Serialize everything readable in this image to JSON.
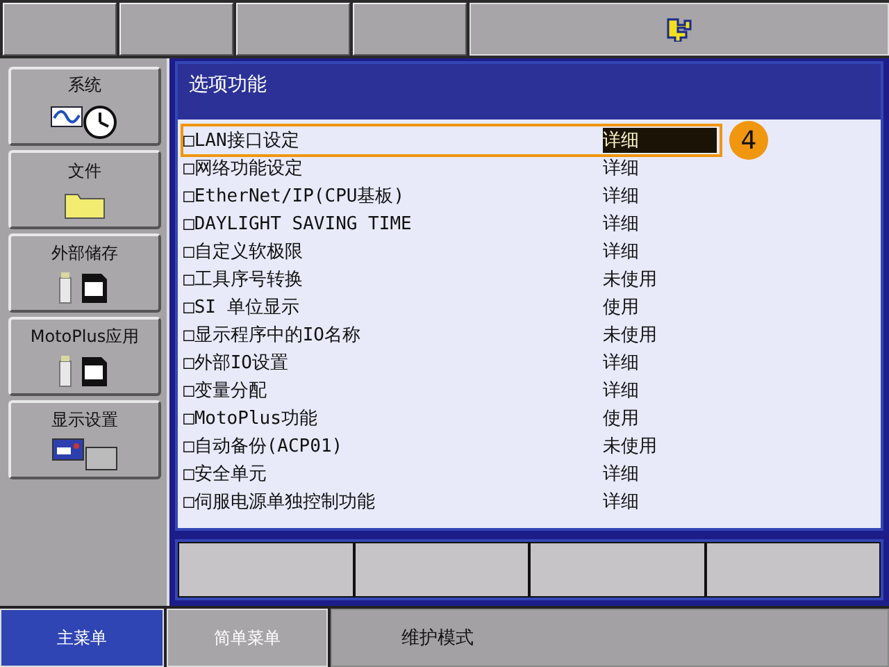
{
  "menu": [
    {
      "label": "系统",
      "kind": "system"
    },
    {
      "label": "文件",
      "kind": "folder"
    },
    {
      "label": "外部储存",
      "kind": "storage"
    },
    {
      "label": "MotoPlus应用",
      "kind": "storage"
    },
    {
      "label": "显示设置",
      "kind": "display"
    }
  ],
  "panel": {
    "title": "选项功能"
  },
  "rows": [
    {
      "label": "□LAN接口设定",
      "value": "详细",
      "selected": true
    },
    {
      "label": "□网络功能设定",
      "value": "详细",
      "selected": false
    },
    {
      "label": "□EtherNet/IP(CPU基板)",
      "value": "详细",
      "selected": false
    },
    {
      "label": "□DAYLIGHT SAVING TIME",
      "value": "详细",
      "selected": false
    },
    {
      "label": "□自定义软极限",
      "value": "详细",
      "selected": false
    },
    {
      "label": "□工具序号转换",
      "value": "未使用",
      "selected": false
    },
    {
      "label": "□SI 单位显示",
      "value": "使用",
      "selected": false
    },
    {
      "label": "□显示程序中的IO名称",
      "value": "未使用",
      "selected": false
    },
    {
      "label": "□外部IO设置",
      "value": "详细",
      "selected": false
    },
    {
      "label": "□变量分配",
      "value": "详细",
      "selected": false
    },
    {
      "label": "□MotoPlus功能",
      "value": "使用",
      "selected": false
    },
    {
      "label": "□自动备份(ACP01)",
      "value": "未使用",
      "selected": false
    },
    {
      "label": "□安全单元",
      "value": "详细",
      "selected": false
    },
    {
      "label": "□伺服电源单独控制功能",
      "value": "详细",
      "selected": false
    }
  ],
  "callout": "4",
  "bottom_tabs": [
    {
      "label": "主菜单",
      "selected": true
    },
    {
      "label": "简单菜单",
      "selected": false
    }
  ],
  "mode": "维护模式"
}
